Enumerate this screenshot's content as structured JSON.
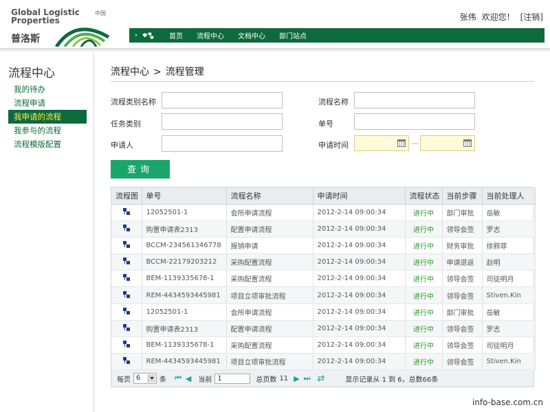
{
  "brand": {
    "logo_en_line1": "Global Logistic",
    "logo_en_line2": "Properties",
    "logo_region": "中国",
    "logo_cn": "普洛斯"
  },
  "user": {
    "name": "张伟",
    "welcome": "欢迎您！",
    "logout": "[注销]"
  },
  "nav": {
    "arrow": "›",
    "items": [
      "首页",
      "流程中心",
      "文档中心",
      "部门站点"
    ]
  },
  "sidebar": {
    "title": "流程中心",
    "items": [
      {
        "label": "我的待办",
        "active": false
      },
      {
        "label": "流程申请",
        "active": false
      },
      {
        "label": "我申请的流程",
        "active": true
      },
      {
        "label": "我参与的流程",
        "active": false
      },
      {
        "label": "流程模版配置",
        "active": false
      }
    ]
  },
  "breadcrumb": {
    "parent": "流程中心",
    "separator": ">",
    "current": "流程管理"
  },
  "form": {
    "category_label": "流程类别名称",
    "category_value": "",
    "name_label": "流程名称",
    "name_value": "",
    "task_label": "任务类别",
    "task_value": "",
    "number_label": "单号",
    "number_value": "",
    "applicant_label": "申请人",
    "applicant_value": "",
    "time_label": "申请时间",
    "date_separator": "—",
    "query_button": "查询"
  },
  "table": {
    "headers": [
      "流程图",
      "单号",
      "流程名称",
      "申请时间",
      "流程状态",
      "当前步骤",
      "当前处理人"
    ],
    "rows": [
      {
        "no": "12052501-1",
        "flow": "会所申请流程",
        "time": "2012-2-14  09:00:34",
        "status": "进行中",
        "step": "部门审批",
        "handler": "岳敏"
      },
      {
        "no": "购置申请表2313",
        "flow": "配置申请流程",
        "time": "2012-2-14  09:00:34",
        "status": "进行中",
        "step": "领导会签",
        "handler": "罗志"
      },
      {
        "no": "BCCM-234561346778",
        "flow": "报销申请",
        "time": "2012-2-14  09:00:34",
        "status": "进行中",
        "step": "财务审批",
        "handler": "徐颢菲"
      },
      {
        "no": "BCCM-22179203212",
        "flow": "采购配置流程",
        "time": "2012-2-14  09:00:34",
        "status": "进行中",
        "step": "申请退返",
        "handler": "赵明"
      },
      {
        "no": "BEM-1139335678-1",
        "flow": "采购配置流程",
        "time": "2012-2-14  09:00:34",
        "status": "进行中",
        "step": "领导会签",
        "handler": "司徒明月"
      },
      {
        "no": "REM-4434593445981",
        "flow": "项目立项审批流程",
        "time": "2012-2-14  09:00:34",
        "status": "进行中",
        "step": "领导会签",
        "handler": "Stiven.Kin"
      },
      {
        "no": "12052501-1",
        "flow": "会所申请流程",
        "time": "2012-2-14  09:00:34",
        "status": "进行中",
        "step": "部门审批",
        "handler": "岳敏"
      },
      {
        "no": "购置申请表2313",
        "flow": "配置申请流程",
        "time": "2012-2-14  09:00:34",
        "status": "进行中",
        "step": "领导会签",
        "handler": "罗志"
      },
      {
        "no": "BEM-1139335678-1",
        "flow": "采购配置流程",
        "time": "2012-2-14  09:00:34",
        "status": "进行中",
        "step": "领导会签",
        "handler": "司徒明月"
      },
      {
        "no": "REM-4434593445981",
        "flow": "项目立项审批流程",
        "time": "2012-2-14  09:00:34",
        "status": "进行中",
        "step": "领导会签",
        "handler": "Stiven.Kin"
      }
    ]
  },
  "pager": {
    "per_page_label": "每页",
    "per_page_value": "6",
    "per_page_unit": "条",
    "current_label": "当前",
    "current_value": "1",
    "total_pages_label": "总页数",
    "total_pages_value": "11",
    "summary": "显示记录从 1 到 6，总数66条"
  },
  "colors": {
    "brand_green": "#0c6a3c",
    "button_green": "#1aa56b",
    "active_text": "#ffe84f",
    "status_green": "#2a9a2a",
    "date_bg": "#fffbd8"
  },
  "watermark": "info-base.com.cn"
}
